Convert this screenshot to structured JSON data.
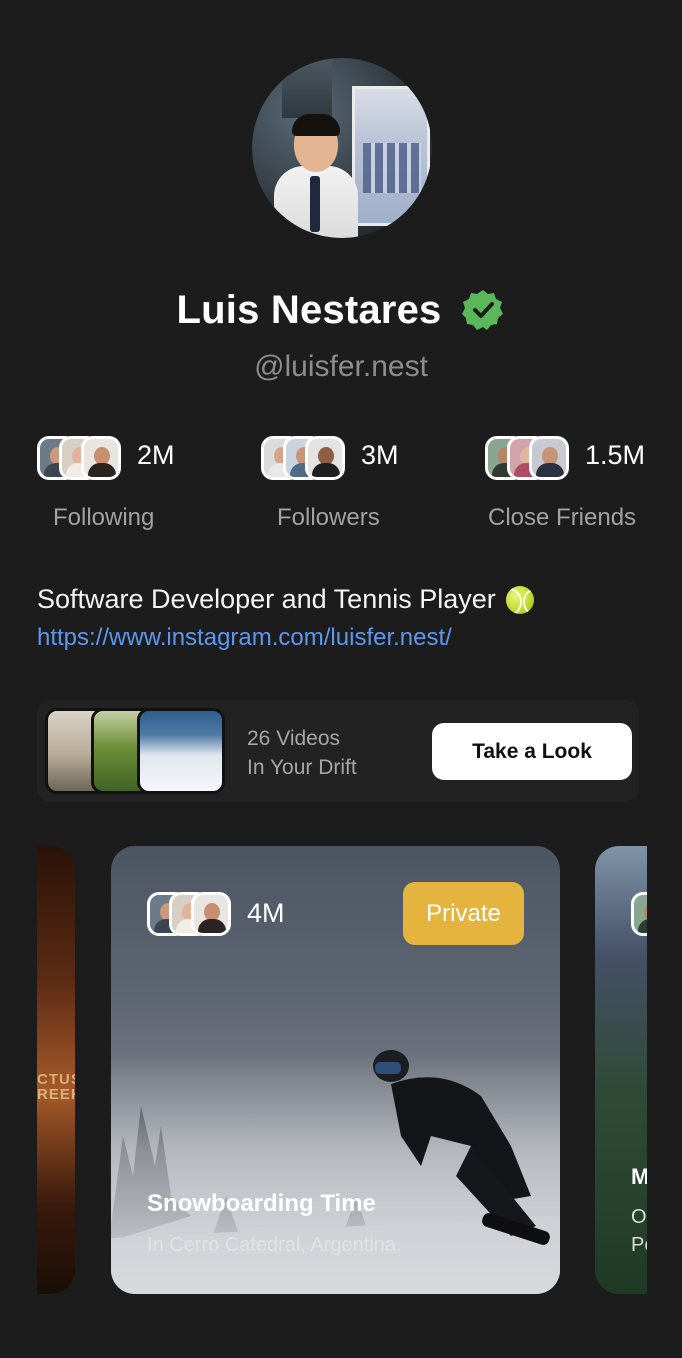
{
  "profile": {
    "name": "Luis Nestares",
    "username": "@luisfer.nest",
    "bio": "Software Developer and Tennis Player",
    "bio_emoji": "tennis-ball-icon",
    "link": "https://www.instagram.com/luisfer.nest/"
  },
  "stats": [
    {
      "value": "2M",
      "label": "Following"
    },
    {
      "value": "3M",
      "label": "Followers"
    },
    {
      "value": "1.5M",
      "label": "Close Friends"
    }
  ],
  "drift": {
    "line1": "26 Videos",
    "line2": "In Your Drift",
    "button": "Take a Look"
  },
  "cards": {
    "left": {
      "text": "CTUS\nREEK"
    },
    "main": {
      "count": "4M",
      "badge": "Private",
      "title": "Snowboarding Time",
      "subtitle": "In Cerro Catedral, Argentina."
    },
    "right": {
      "title_initial": "M",
      "sub1": "O",
      "sub2": "Pe"
    }
  },
  "colors": {
    "background": "#1c1c1c",
    "verified": "#5bb85a",
    "link": "#5f97ee",
    "private_badge": "#e4b43f"
  }
}
